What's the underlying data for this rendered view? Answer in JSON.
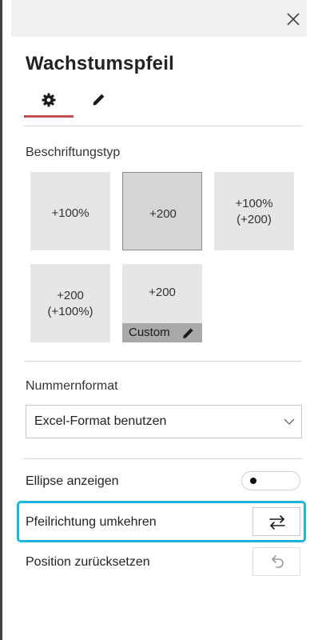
{
  "panel": {
    "title": "Wachstumspfeil",
    "tabs": [
      {
        "icon": "gear-icon",
        "active": true
      },
      {
        "icon": "pencil-icon",
        "active": false
      }
    ],
    "accent_color": "#c0504d",
    "highlight_color": "#1eb4de"
  },
  "label_type": {
    "heading": "Beschriftungstyp",
    "options": [
      {
        "label": "+100%",
        "selected": false
      },
      {
        "label": "+200",
        "selected": true
      },
      {
        "label": "+100%\n(+200)",
        "selected": false
      },
      {
        "label": "+200\n(+100%)",
        "selected": false
      },
      {
        "label": "+200",
        "custom_label": "Custom",
        "selected": false
      }
    ]
  },
  "number_format": {
    "heading": "Nummernformat",
    "value": "Excel-Format benutzen"
  },
  "settings": {
    "show_ellipse": {
      "label": "Ellipse anzeigen",
      "enabled": false
    },
    "reverse_direction": {
      "label": "Pfeilrichtung umkehren"
    },
    "reset_position": {
      "label": "Position zurücksetzen"
    }
  }
}
